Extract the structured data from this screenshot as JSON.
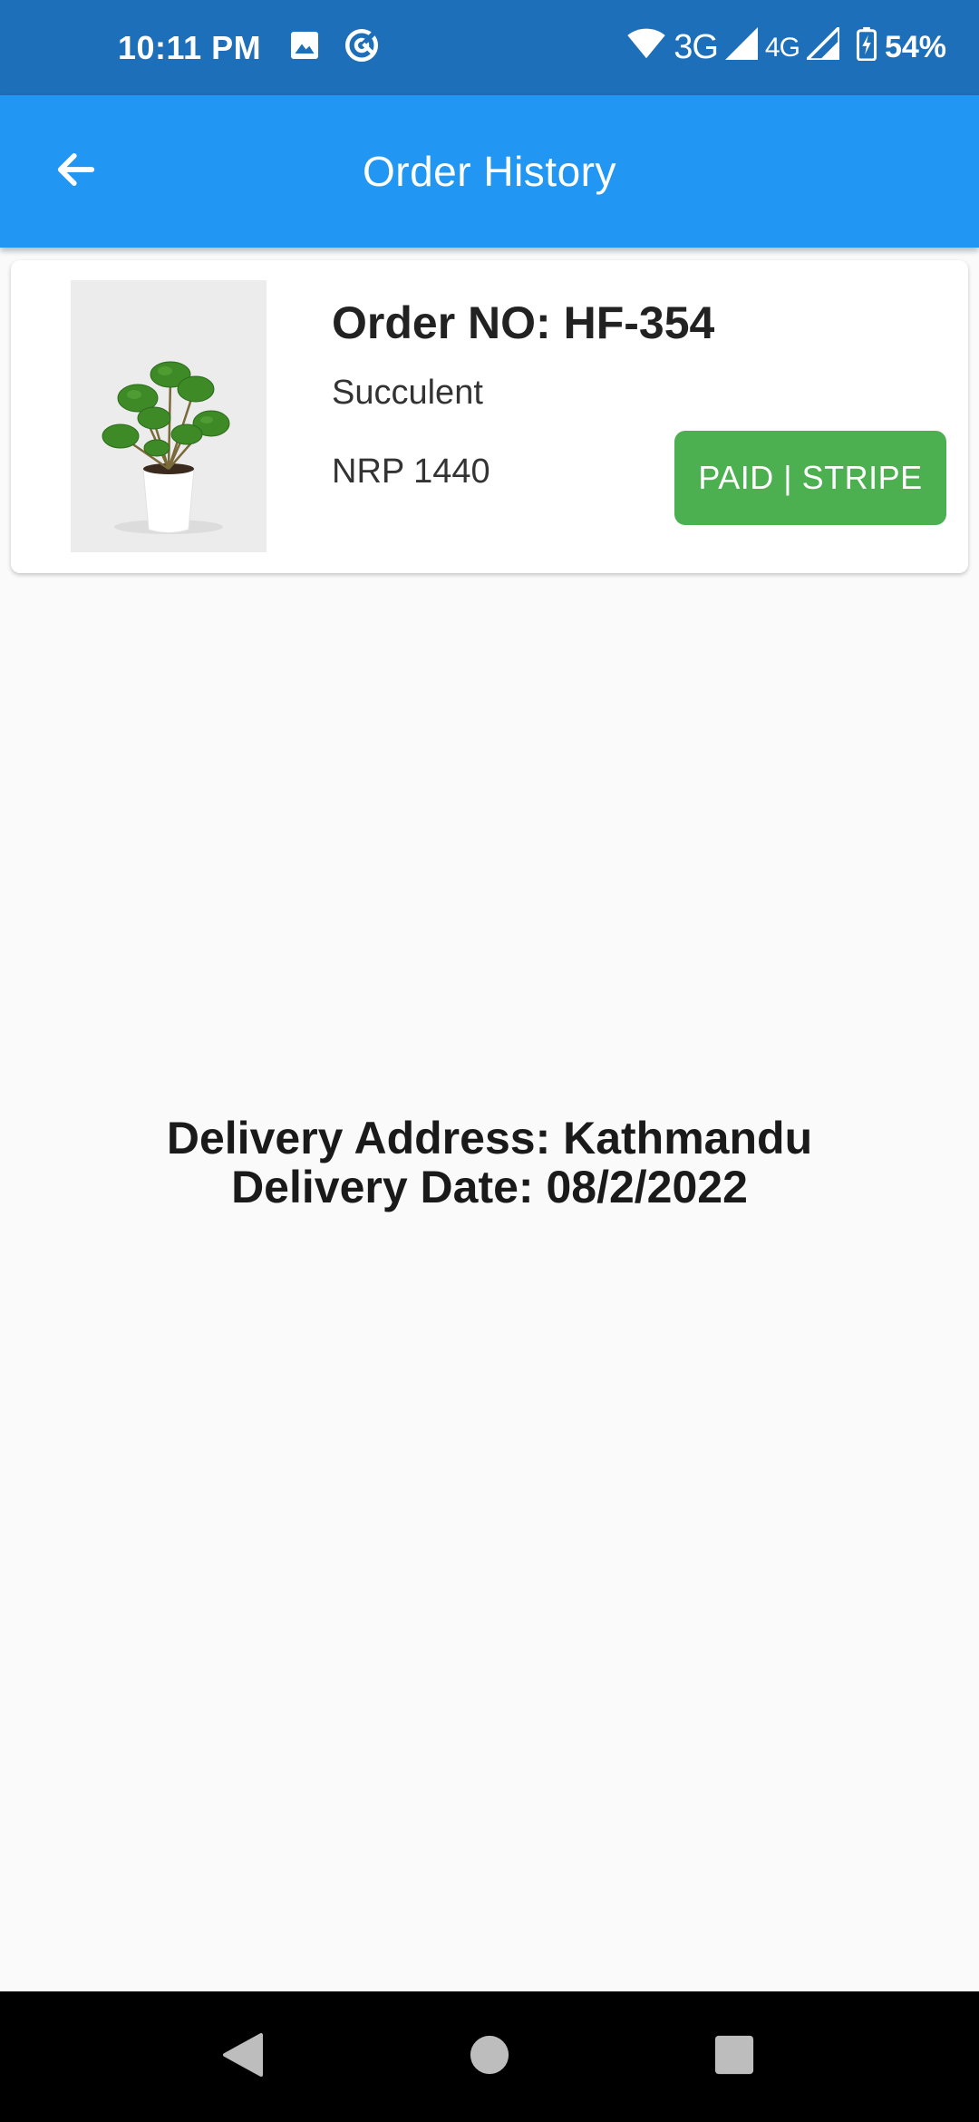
{
  "status_bar": {
    "time": "10:11 PM",
    "left_icons": [
      "image-icon",
      "data-saver-icon"
    ],
    "network_1": "3G",
    "network_2": "4G",
    "battery": "54%"
  },
  "app_bar": {
    "title": "Order History",
    "back_icon": "arrow-back-icon"
  },
  "orders": [
    {
      "order_no": "Order NO: HF-354",
      "product_name": "Succulent",
      "price": "NRP 1440",
      "payment_status": "PAID | STRIPE"
    }
  ],
  "delivery": {
    "address": "Delivery Address: Kathmandu",
    "date": "Delivery Date: 08/2/2022"
  },
  "nav_bar": {
    "buttons": [
      "back-triangle-icon",
      "home-circle-icon",
      "recents-square-icon"
    ]
  },
  "colors": {
    "status_bar": "#1c6fb8",
    "app_bar": "#2196f3",
    "paid_badge": "#4caf50",
    "background": "#fafafa"
  }
}
